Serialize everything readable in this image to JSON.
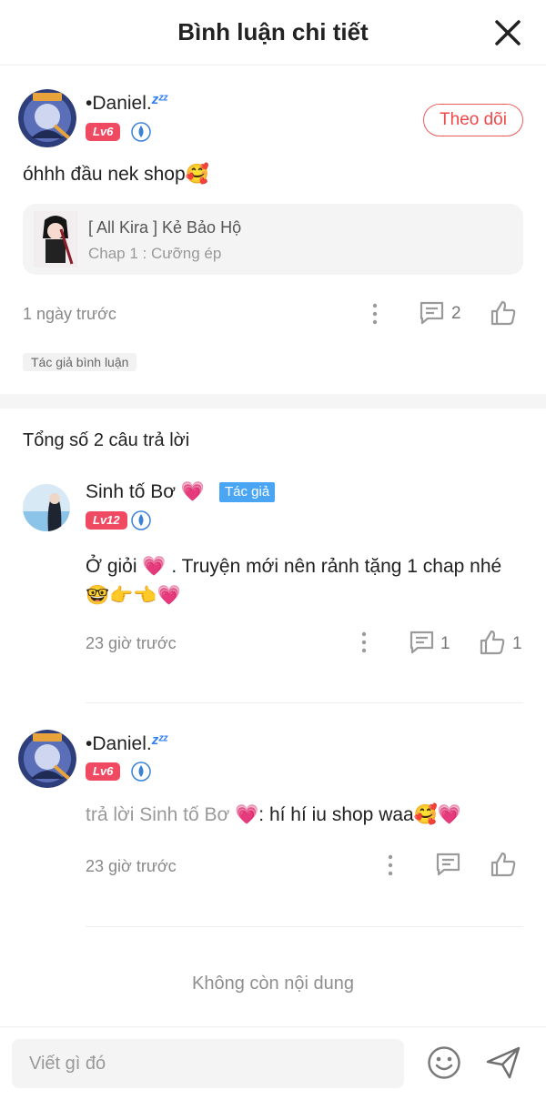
{
  "header": {
    "title": "Bình luận chi tiết"
  },
  "main_comment": {
    "username": "•Daniel.",
    "level": "Lv6",
    "follow_label": "Theo dõi",
    "text": "óhhh đầu nek shop",
    "story": {
      "title": "[ All Kira ] Kẻ Bảo Hộ",
      "chapter": "Chap 1 : Cưỡng ép"
    },
    "time": "1 ngày trước",
    "reply_count": "2",
    "tag": "Tác giả bình luận"
  },
  "total_replies": "Tổng số 2 câu trả lời",
  "replies": [
    {
      "username": "Sinh tố Bơ",
      "author_tag": "Tác giả",
      "level": "Lv12",
      "text_line1": "Ở giỏi",
      "text_line1b": ". Truyện mới nên rảnh tặng 1 chap nhé",
      "time": "23 giờ trước",
      "reply_count": "1",
      "like_count": "1"
    },
    {
      "username": "•Daniel.",
      "level": "Lv6",
      "reply_prefix": "trả lời Sinh tố Bơ",
      "text": ": hí hí iu shop waa",
      "time": "23 giờ trước"
    }
  ],
  "end_text": "Không còn nội dung",
  "input": {
    "placeholder": "Viết gì đó"
  },
  "colors": {
    "accent_red": "#ef4848",
    "level_badge": "#f04a63",
    "author_tag": "#4aa6f5",
    "drop_badge": "#3b82d6"
  }
}
